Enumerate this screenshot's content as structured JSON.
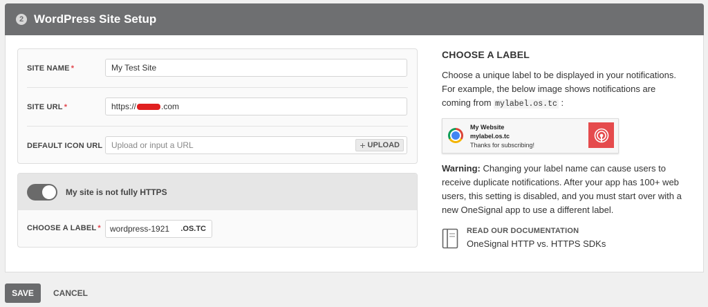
{
  "header": {
    "step": "2",
    "title": "WordPress Site Setup"
  },
  "form": {
    "site_name": {
      "label": "SITE NAME",
      "value": "My Test Site"
    },
    "site_url": {
      "label": "SITE URL",
      "value_prefix": "https://",
      "value_suffix": ".com"
    },
    "default_icon": {
      "label": "DEFAULT ICON URL",
      "placeholder": "Upload or input a URL",
      "upload_label": "UPLOAD"
    },
    "required_mark": "*"
  },
  "https": {
    "toggle_label": "My site is not fully HTTPS",
    "toggle_on": true,
    "label_field": {
      "label": "CHOOSE A LABEL",
      "value": "wordpress-1921",
      "suffix": ".OS.TC"
    }
  },
  "side": {
    "heading": "CHOOSE A LABEL",
    "intro": "Choose a unique label to be displayed in your notifications. For example, the below image shows notifications are coming from",
    "intro_code": "mylabel.os.tc",
    "intro_end": ":",
    "notification": {
      "title": "My Website",
      "site": "mylabel.os.tc",
      "body": "Thanks for subscribing!"
    },
    "warning_bold": "Warning:",
    "warning_text": " Changing your label name can cause users to receive duplicate notifications. After your app has 100+ web users, this setting is disabled, and you must start over with a new OneSignal app to use a different label.",
    "doc_heading": "READ OUR DOCUMENTATION",
    "doc_link": "OneSignal HTTP vs. HTTPS SDKs"
  },
  "actions": {
    "save": "SAVE",
    "cancel": "CANCEL"
  },
  "colors": {
    "header": "#6e6f71",
    "required": "#e2454c",
    "brand_red": "#e54b4d",
    "save": "#6a6b6d"
  }
}
